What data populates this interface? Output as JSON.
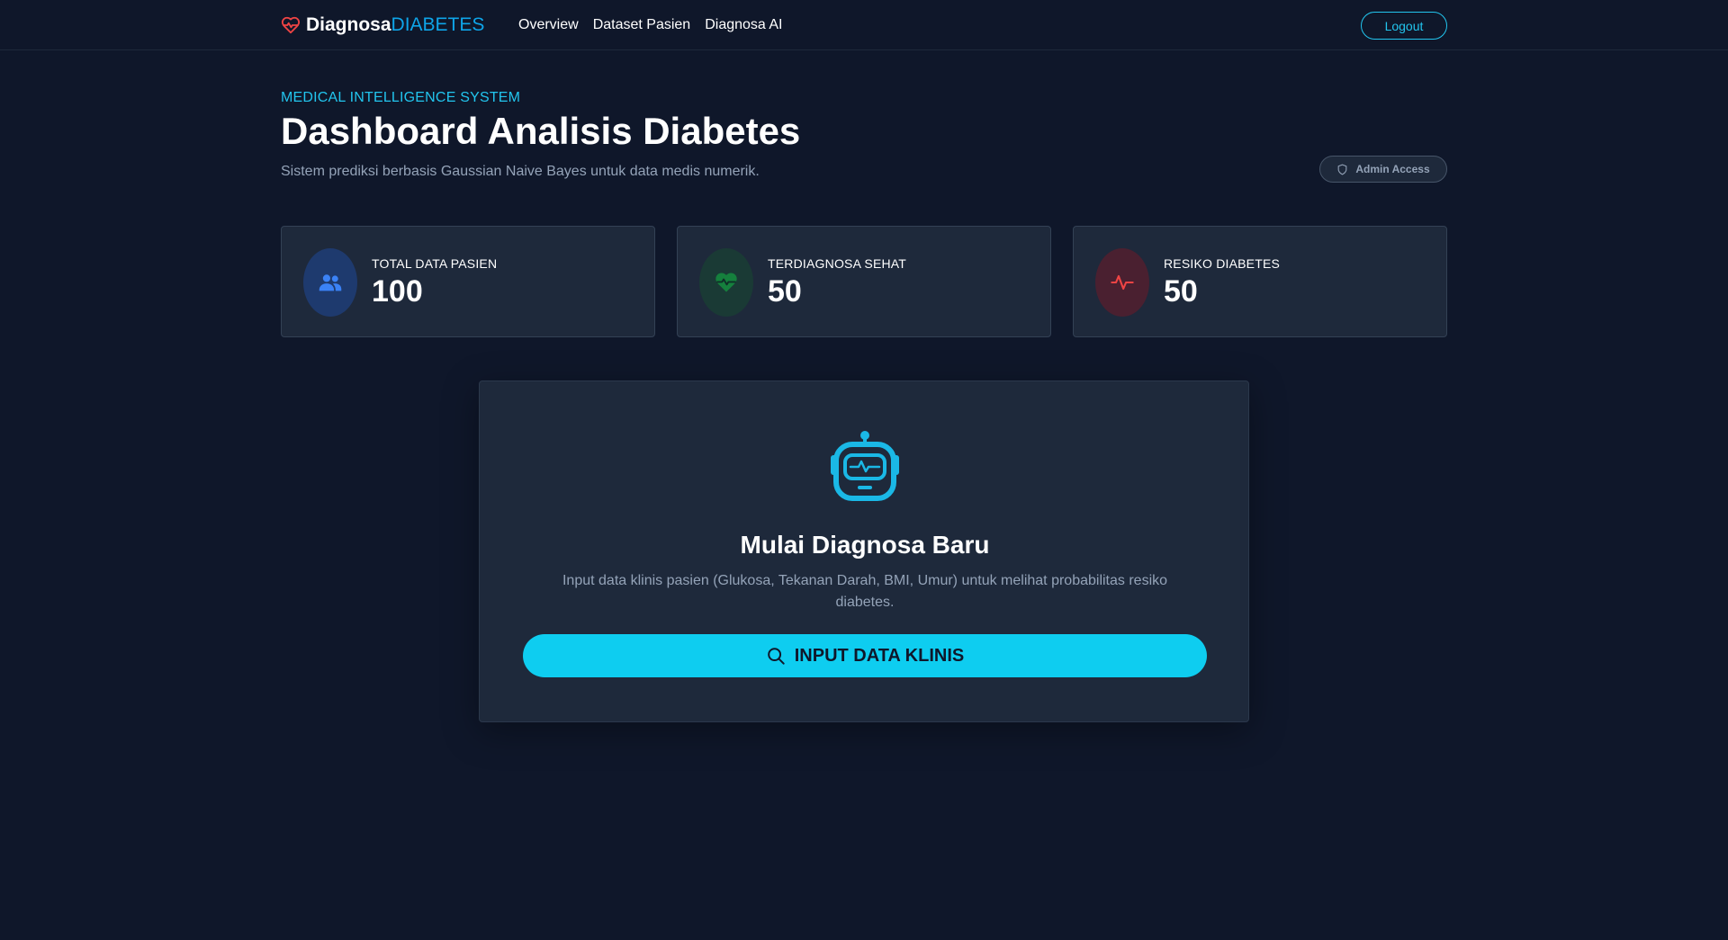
{
  "brand": {
    "name_bold": "Diagnosa",
    "name_accent": "DIABETES",
    "icon": "heart-pulse-icon"
  },
  "nav": {
    "links": [
      {
        "label": "Overview"
      },
      {
        "label": "Dataset Pasien"
      },
      {
        "label": "Diagnosa AI"
      }
    ],
    "logout_label": "Logout"
  },
  "header": {
    "eyebrow": "MEDICAL INTELLIGENCE SYSTEM",
    "title": "Dashboard Analisis Diabetes",
    "subtitle": "Sistem prediksi berbasis Gaussian Naive Bayes untuk data medis numerik.",
    "badge": "Admin Access",
    "badge_icon": "shield-icon"
  },
  "stats": [
    {
      "label": "TOTAL DATA PASIEN",
      "value": "100",
      "icon": "users-icon",
      "color": "#3b82f6"
    },
    {
      "label": "TERDIAGNOSA SEHAT",
      "value": "50",
      "icon": "heart-pulse-icon",
      "color": "#22c55e"
    },
    {
      "label": "RESIKO DIABETES",
      "value": "50",
      "icon": "activity-icon",
      "color": "#ef4444"
    }
  ],
  "diagnosa": {
    "icon": "robot-icon",
    "title": "Mulai Diagnosa Baru",
    "description": "Input data klinis pasien (Glukosa, Tekanan Darah, BMI, Umur) untuk melihat probabilitas resiko diabetes.",
    "button_label": "INPUT DATA KLINIS",
    "button_icon": "search-icon"
  },
  "colors": {
    "background": "#0f172a",
    "card": "#1e293b",
    "accent": "#0ecdf0",
    "brand_heart": "#ef4444",
    "muted_text": "#94a3b8"
  }
}
